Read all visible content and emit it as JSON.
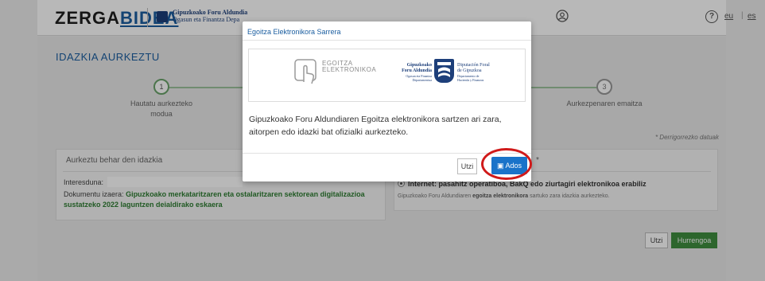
{
  "header": {
    "logo_part1": "ZERGA",
    "logo_part2": "BIDEA",
    "gip_line1": "Gipuzkoako Foru Aldundia",
    "gip_line2": "Ogasun eta Finantza Depa",
    "help_icon": "?",
    "lang_eu": "eu",
    "lang_sep": "|",
    "lang_es": "es",
    "icons": {
      "user": "user-circle-icon",
      "help": "question-circle-icon"
    }
  },
  "main": {
    "title": "IDAZKIA AURKEZTU",
    "steps": [
      {
        "num": "1",
        "label": "Hautatu aurkezteko modua"
      },
      {
        "num": "3",
        "label": "Aurkezpenaren emaitza"
      }
    ],
    "required_note": "* Derrigorrezko datuak",
    "doc_panel": {
      "heading": "Aurkeztu behar den idazkia",
      "interested_label": "Interesduna:",
      "status_label": "Dokumentu izaera:",
      "status_value": "Gipuzkoako merkataritzaren eta ostalaritzaren sektorean digitalizazioa sustatzeko 2022 laguntzen deialdirako eskaera"
    },
    "method_panel": {
      "heading_fragment": "*",
      "option_label": "Internet: pasahitz operatiboa, BakQ edo ziurtagiri elektronikoa erabiliz",
      "option_sub_prefix": "Gipuzkoako Foru Aldundiaren ",
      "option_sub_bold": "egoitza elektronikora",
      "option_sub_suffix": " sartuko zara idazkia aurkezteko."
    },
    "buttons": {
      "cancel": "Utzi",
      "next": "Hurrengoa"
    }
  },
  "modal": {
    "title": "Egoitza Elektronikora Sarrera",
    "ee_logo_line1": "EGOITZA",
    "ee_logo_line2": "ELEKTRONIKOA",
    "gip_left_line1": "Gipuzkoako",
    "gip_left_line2": "Foru Aldundia",
    "gip_left_sub1": "Ogasun eta Finantza",
    "gip_left_sub2": "Departamentua",
    "gip_right_line1": "Diputación Foral",
    "gip_right_line2": "de Gipuzkoa",
    "gip_right_sub1": "Departamento de",
    "gip_right_sub2": "Hacienda y Finanzas",
    "body": "Gipuzkoako Foru Aldundiaren Egoitza elektronikora sartzen ari zara, aitorpen edo idazki bat ofizialki aurkezteko.",
    "cancel_label": "Utzi",
    "accept_label": "Ados",
    "accept_icon": "shield-icon",
    "colors": {
      "accent": "#1a73c9",
      "highlight_ring": "#d01a1a",
      "green": "#3f8e3f"
    }
  }
}
